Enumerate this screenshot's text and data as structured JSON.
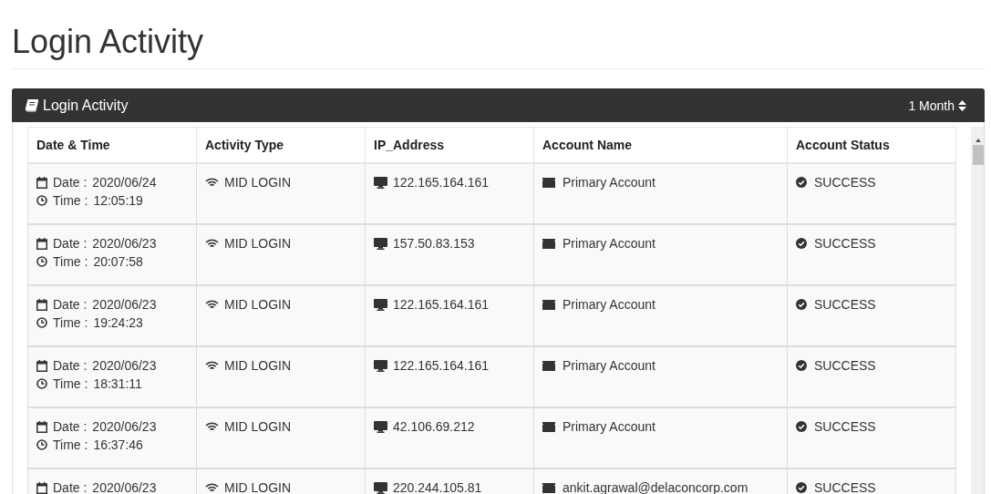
{
  "page_title": "Login Activity",
  "panel": {
    "title": "Login Activity",
    "period": "1 Month"
  },
  "table": {
    "columns": [
      "Date & Time",
      "Activity Type",
      "IP_Address",
      "Account Name",
      "Account Status"
    ],
    "rows": [
      {
        "date_label": "Date :",
        "date": "2020/06/24",
        "time_label": "Time :",
        "time": "12:05:19",
        "activity": "MID LOGIN",
        "ip": "122.165.164.161",
        "account": "Primary Account",
        "status": "SUCCESS"
      },
      {
        "date_label": "Date :",
        "date": "2020/06/23",
        "time_label": "Time :",
        "time": "20:07:58",
        "activity": "MID LOGIN",
        "ip": "157.50.83.153",
        "account": "Primary Account",
        "status": "SUCCESS"
      },
      {
        "date_label": "Date :",
        "date": "2020/06/23",
        "time_label": "Time :",
        "time": "19:24:23",
        "activity": "MID LOGIN",
        "ip": "122.165.164.161",
        "account": "Primary Account",
        "status": "SUCCESS"
      },
      {
        "date_label": "Date :",
        "date": "2020/06/23",
        "time_label": "Time :",
        "time": "18:31:11",
        "activity": "MID LOGIN",
        "ip": "122.165.164.161",
        "account": "Primary Account",
        "status": "SUCCESS"
      },
      {
        "date_label": "Date :",
        "date": "2020/06/23",
        "time_label": "Time :",
        "time": "16:37:46",
        "activity": "MID LOGIN",
        "ip": "42.106.69.212",
        "account": "Primary Account",
        "status": "SUCCESS"
      },
      {
        "date_label": "Date :",
        "date": "2020/06/23",
        "activity": "MID LOGIN",
        "ip": "220.244.105.81",
        "account": "ankit.agrawal@delaconcorp.com",
        "status": "SUCCESS"
      }
    ]
  }
}
